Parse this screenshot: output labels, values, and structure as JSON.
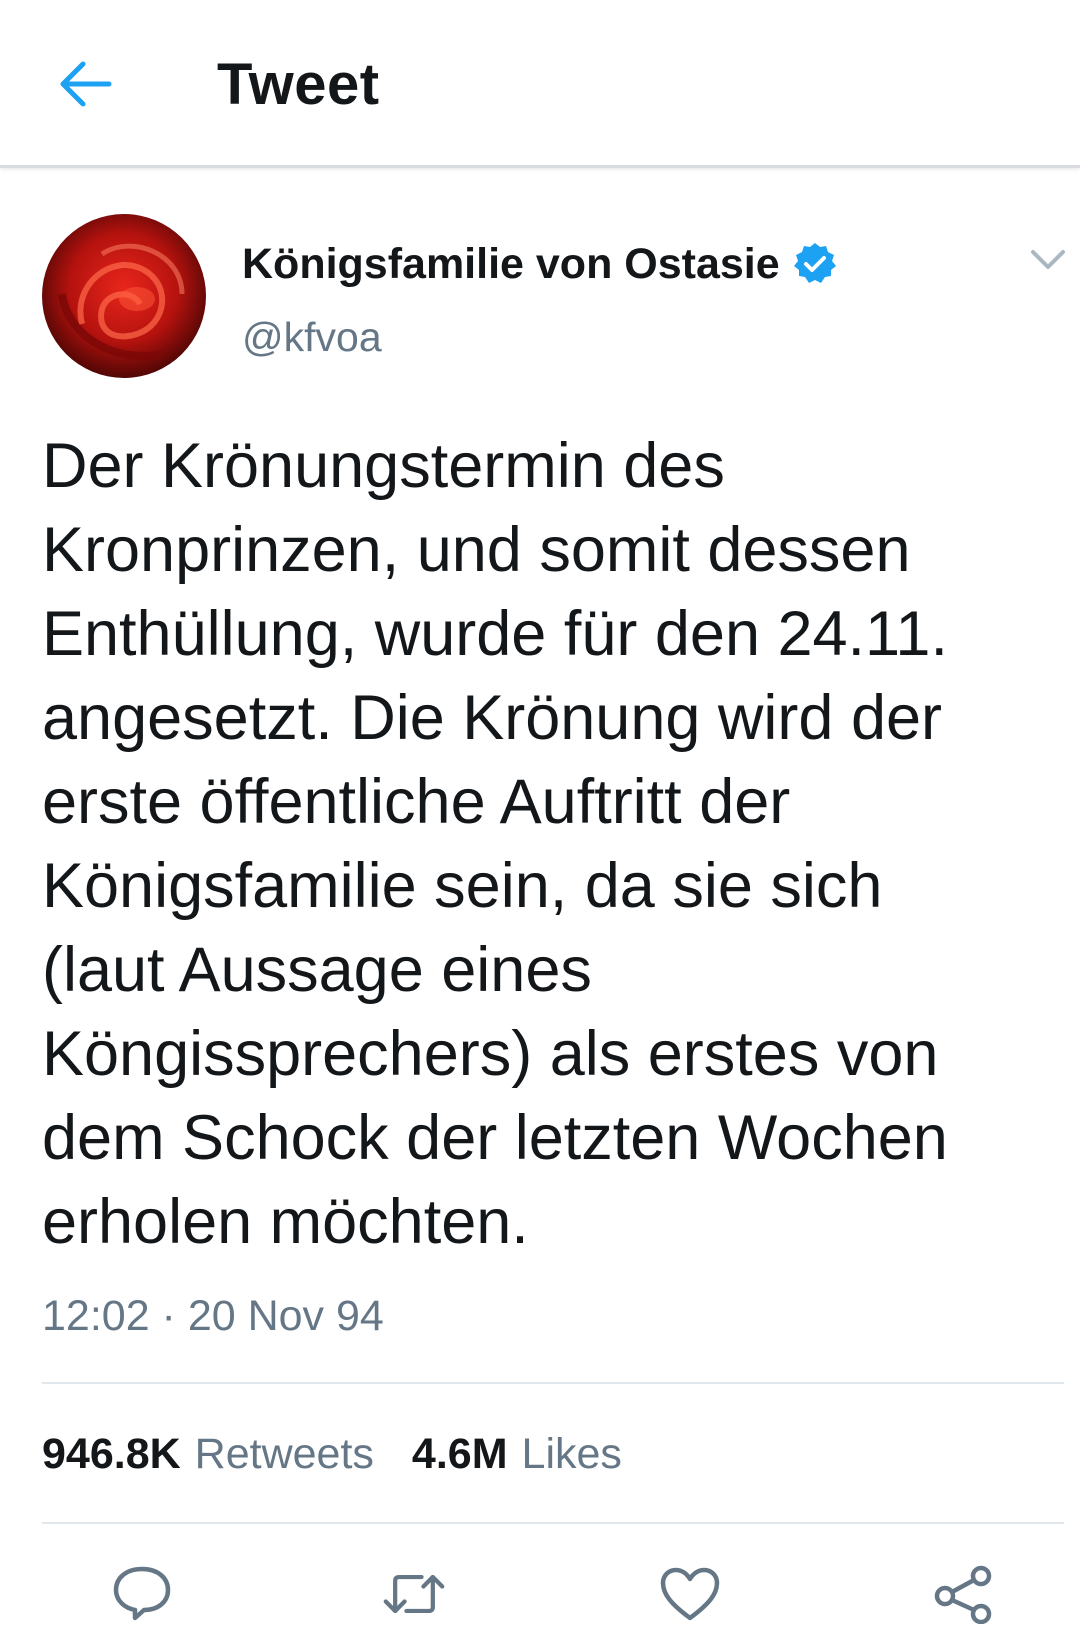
{
  "header": {
    "title": "Tweet",
    "back_icon": "arrow-left-icon",
    "accent": "#1da1f2"
  },
  "tweet": {
    "author": {
      "display_name": "Königsfamilie von Ostasie",
      "handle": "@kfvoa",
      "verified": true,
      "verified_color": "#1da1f2"
    },
    "text_lines": [
      "Der Krönungstermin des",
      "Kronprinzen, und somit dessen",
      "Enthüllung, wurde für den 24.11.",
      "angesetzt. Die Krönung wird der",
      "erste öffentliche Auftritt der",
      "Königsfamilie sein, da sie sich",
      "(laut Aussage eines",
      "Köngissprechers) als erstes von",
      "dem Schock der letzten Wochen",
      "erholen möchten."
    ],
    "timestamp": "12:02 · 20 Nov 94",
    "stats": {
      "retweets_count": "946.8K",
      "retweets_label": "Retweets",
      "likes_count": "4.6M",
      "likes_label": "Likes"
    }
  },
  "actions": [
    {
      "name": "reply",
      "icon": "reply-icon"
    },
    {
      "name": "retweet",
      "icon": "retweet-icon"
    },
    {
      "name": "like",
      "icon": "heart-icon"
    },
    {
      "name": "share",
      "icon": "share-icon"
    }
  ],
  "colors": {
    "text_primary": "#14171a",
    "text_secondary": "#657786",
    "divider": "#e1e8ed",
    "icon_gray": "#657786"
  }
}
